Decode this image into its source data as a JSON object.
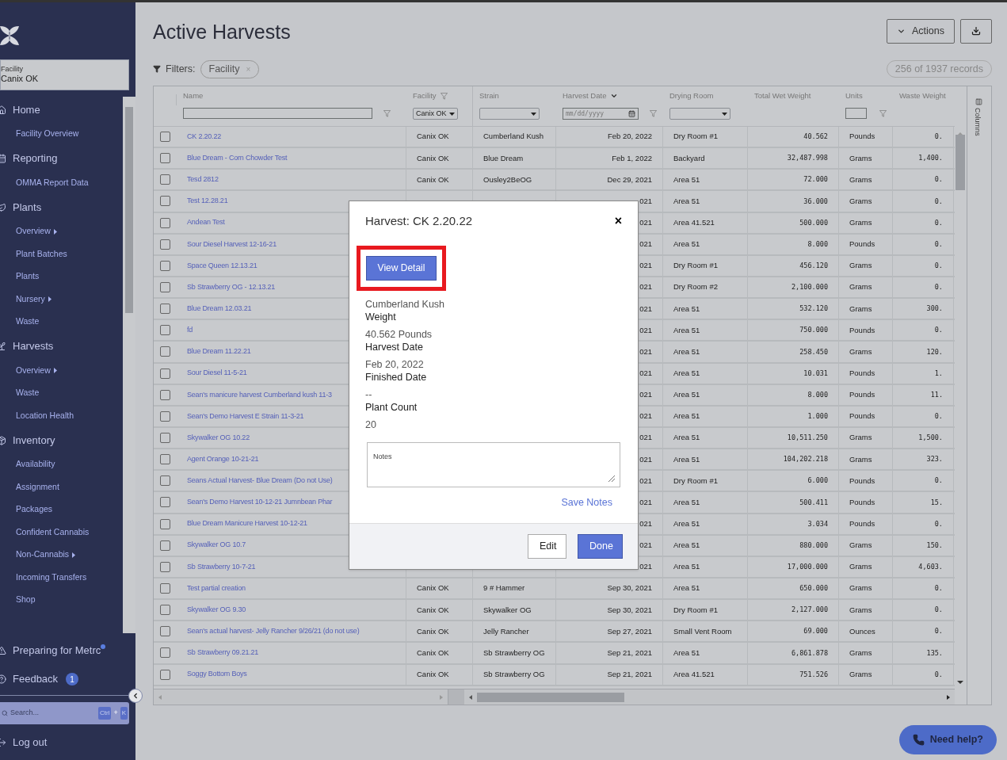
{
  "sidebar": {
    "facility": {
      "label": "Facility",
      "value": "Canix OK"
    },
    "items": [
      {
        "kind": "section",
        "label": "Home"
      },
      {
        "kind": "link",
        "label": "Facility Overview",
        "submenu": false
      },
      {
        "kind": "section",
        "label": "Reporting"
      },
      {
        "kind": "link",
        "label": "OMMA Report Data",
        "submenu": false
      },
      {
        "kind": "section",
        "label": "Plants"
      },
      {
        "kind": "link",
        "label": "Overview",
        "submenu": true
      },
      {
        "kind": "link",
        "label": "Plant Batches",
        "submenu": false
      },
      {
        "kind": "link",
        "label": "Plants",
        "submenu": false
      },
      {
        "kind": "link",
        "label": "Nursery",
        "submenu": true
      },
      {
        "kind": "link",
        "label": "Waste",
        "submenu": false
      },
      {
        "kind": "section",
        "label": "Harvests"
      },
      {
        "kind": "link",
        "label": "Overview",
        "submenu": true
      },
      {
        "kind": "link",
        "label": "Waste",
        "submenu": false
      },
      {
        "kind": "link",
        "label": "Location Health",
        "submenu": false
      },
      {
        "kind": "section",
        "label": "Inventory"
      },
      {
        "kind": "link",
        "label": "Availability",
        "submenu": false
      },
      {
        "kind": "link",
        "label": "Assignment",
        "submenu": false
      },
      {
        "kind": "link",
        "label": "Packages",
        "submenu": false
      },
      {
        "kind": "link",
        "label": "Confident Cannabis",
        "submenu": false
      },
      {
        "kind": "link",
        "label": "Non-Cannabis",
        "submenu": true
      },
      {
        "kind": "link",
        "label": "Incoming Transfers",
        "submenu": false
      },
      {
        "kind": "link",
        "label": "Shop",
        "submenu": false
      }
    ],
    "bottom": [
      {
        "label": "Preparing for Metrc",
        "dot": true
      },
      {
        "label": "Feedback",
        "badge": "1"
      }
    ],
    "search": {
      "placeholder": "Search...",
      "keys": [
        "Ctrl",
        "+",
        "K"
      ]
    },
    "logout": "Log out"
  },
  "page": {
    "title": "Active Harvests",
    "actions": "Actions",
    "filters_label": "Filters:",
    "filter_chips": [
      {
        "label": "Facility",
        "remove": "×"
      }
    ],
    "records": "256 of 1937 records"
  },
  "table": {
    "columns": [
      {
        "label": "Name",
        "kind": "text",
        "sorted": false,
        "header_filter": false
      },
      {
        "label": "Facility",
        "kind": "select",
        "value": "Canix OK",
        "sorted": false,
        "header_filter": true
      },
      {
        "label": "Strain",
        "kind": "select",
        "sorted": false,
        "header_filter": false
      },
      {
        "label": "Harvest Date",
        "kind": "date",
        "placeholder": "mm/dd/yyyy",
        "sorted": true,
        "header_filter": false
      },
      {
        "label": "Drying Room",
        "kind": "select",
        "sorted": false,
        "header_filter": false
      },
      {
        "label": "Total Wet Weight",
        "kind": "plain",
        "sorted": false,
        "header_filter": false
      },
      {
        "label": "Units",
        "kind": "box",
        "sorted": false,
        "header_filter": false
      },
      {
        "label": "Waste Weight",
        "kind": "plain",
        "sorted": false,
        "header_filter": false
      }
    ],
    "side_panel": "Columns",
    "rows": [
      {
        "checked": false,
        "cells": [
          "CK 2.20.22",
          "Canix OK",
          "Cumberland Kush",
          "Feb 20, 2022",
          "Dry Room #1",
          "40.562",
          "Pounds",
          "0."
        ]
      },
      {
        "checked": false,
        "cells": [
          "Blue Dream - Corn Chowder Test",
          "Canix OK",
          "Blue Dream",
          "Feb 1, 2022",
          "Backyard",
          "32,487.998",
          "Grams",
          "1,400."
        ]
      },
      {
        "checked": false,
        "cells": [
          "Tesd 2812",
          "Canix OK",
          "Ousley2BeOG",
          "Dec 29, 2021",
          "Area 51",
          "72.000",
          "Grams",
          "0."
        ]
      },
      {
        "checked": false,
        "cells": [
          "Test 12.28.21",
          null,
          null,
          "021",
          "Area 51",
          "36.000",
          "Grams",
          "0."
        ]
      },
      {
        "checked": false,
        "cells": [
          "Andean Test",
          null,
          null,
          "021",
          "Area 41.521",
          "500.000",
          "Grams",
          "0."
        ]
      },
      {
        "checked": false,
        "cells": [
          "Sour Diesel Harvest 12-16-21",
          null,
          null,
          "021",
          "Area 51",
          "8.000",
          "Pounds",
          "0."
        ]
      },
      {
        "checked": false,
        "cells": [
          "Space Queen 12.13.21",
          null,
          null,
          "021",
          "Dry Room #1",
          "456.120",
          "Grams",
          "0."
        ]
      },
      {
        "checked": false,
        "cells": [
          "Sb Strawberry OG - 12.13.21",
          null,
          null,
          "021",
          "Dry Room #2",
          "2,100.000",
          "Grams",
          "0."
        ]
      },
      {
        "checked": false,
        "cells": [
          "Blue Dream 12.03.21",
          null,
          null,
          "021",
          "Area 51",
          "532.120",
          "Grams",
          "300."
        ]
      },
      {
        "checked": false,
        "cells": [
          "fd",
          null,
          null,
          "021",
          "Area 51",
          "750.000",
          "Pounds",
          "0."
        ]
      },
      {
        "checked": false,
        "cells": [
          "Blue Dream 11.22.21",
          null,
          null,
          "021",
          "Area 51",
          "258.450",
          "Grams",
          "120."
        ]
      },
      {
        "checked": false,
        "cells": [
          "Sour Diesel 11-5-21",
          null,
          null,
          "021",
          "Area 51",
          "10.031",
          "Pounds",
          "1."
        ]
      },
      {
        "checked": false,
        "cells": [
          "Sean's manicure harvest Cumberland kush 11-3",
          null,
          null,
          "021",
          "Area 51",
          "8.000",
          "Pounds",
          "11."
        ]
      },
      {
        "checked": false,
        "cells": [
          "Sean's Demo Harvest E Strain 11-3-21",
          null,
          null,
          "021",
          "Area 51",
          "1.000",
          "Pounds",
          "0."
        ]
      },
      {
        "checked": false,
        "cells": [
          "Skywalker OG 10.22",
          null,
          null,
          "021",
          "Area 51",
          "10,511.250",
          "Grams",
          "1,500."
        ]
      },
      {
        "checked": false,
        "cells": [
          "Agent Orange 10-21-21",
          null,
          null,
          "021",
          "Area 51",
          "104,202.218",
          "Grams",
          "323."
        ]
      },
      {
        "checked": false,
        "cells": [
          "Seans Actual Harvest- Blue Dream (Do not Use)",
          null,
          null,
          "021",
          "Dry Room #1",
          "6.000",
          "Pounds",
          "0."
        ]
      },
      {
        "checked": false,
        "cells": [
          "Sean's Demo Harvest 10-12-21 Jumnbean Phar",
          null,
          null,
          "021",
          "Area 51",
          "500.411",
          "Pounds",
          "15."
        ]
      },
      {
        "checked": false,
        "cells": [
          "Blue Dream Manicure Harvest 10-12-21",
          null,
          null,
          "021",
          "Area 51",
          "3.034",
          "Pounds",
          "0."
        ]
      },
      {
        "checked": false,
        "cells": [
          "Skywalker OG 10.7",
          null,
          null,
          "021",
          "Area 51",
          "880.000",
          "Grams",
          "150."
        ]
      },
      {
        "checked": false,
        "cells": [
          "Sb Strawberry 10-7-21",
          null,
          null,
          "021",
          "Area 51",
          "17,000.000",
          "Grams",
          "4,603."
        ]
      },
      {
        "checked": false,
        "cells": [
          "Test partial creation",
          "Canix OK",
          "9 # Hammer",
          "Sep 30, 2021",
          "Area 51",
          "650.000",
          "Grams",
          "0."
        ]
      },
      {
        "checked": false,
        "cells": [
          "Skywalker OG 9.30",
          "Canix OK",
          "Skywalker OG",
          "Sep 30, 2021",
          "Dry Room #1",
          "2,127.000",
          "Grams",
          "0."
        ]
      },
      {
        "checked": false,
        "cells": [
          "Sean's actual harvest- Jelly Rancher 9/26/21 (do not use)",
          "Canix OK",
          "Jelly Rancher",
          "Sep 27, 2021",
          "Small Vent Room",
          "69.000",
          "Ounces",
          "0."
        ]
      },
      {
        "checked": false,
        "cells": [
          "Sb Strawberry 09.21.21",
          "Canix OK",
          "Sb Strawberry OG",
          "Sep 21, 2021",
          "Area 51",
          "6,861.878",
          "Grams",
          "135."
        ]
      },
      {
        "checked": false,
        "cells": [
          "Soggy Bottom Boys",
          "Canix OK",
          "Sb Strawberry OG",
          "Sep 21, 2021",
          "Area 41.521",
          "751.526",
          "Grams",
          "0."
        ]
      }
    ]
  },
  "modal": {
    "title": "Harvest: CK 2.20.22",
    "close": "×",
    "primary": "View Detail",
    "highlighted": true,
    "lines": [
      {
        "kind": "value",
        "text": "Cumberland Kush"
      },
      {
        "kind": "label",
        "text": "Weight"
      },
      {
        "kind": "value",
        "text": "40.562 Pounds"
      },
      {
        "kind": "label",
        "text": "Harvest Date"
      },
      {
        "kind": "value",
        "text": "Feb 20, 2022"
      },
      {
        "kind": "label",
        "text": "Finished Date"
      },
      {
        "kind": "value",
        "text": "--"
      },
      {
        "kind": "label",
        "text": "Plant Count"
      },
      {
        "kind": "value",
        "text": "20"
      }
    ],
    "notes_placeholder": "Notes",
    "save": "Save Notes",
    "buttons": [
      {
        "label": "Edit",
        "kind": "secondary"
      },
      {
        "label": "Done",
        "kind": "primary"
      }
    ]
  },
  "help": "Need help?"
}
